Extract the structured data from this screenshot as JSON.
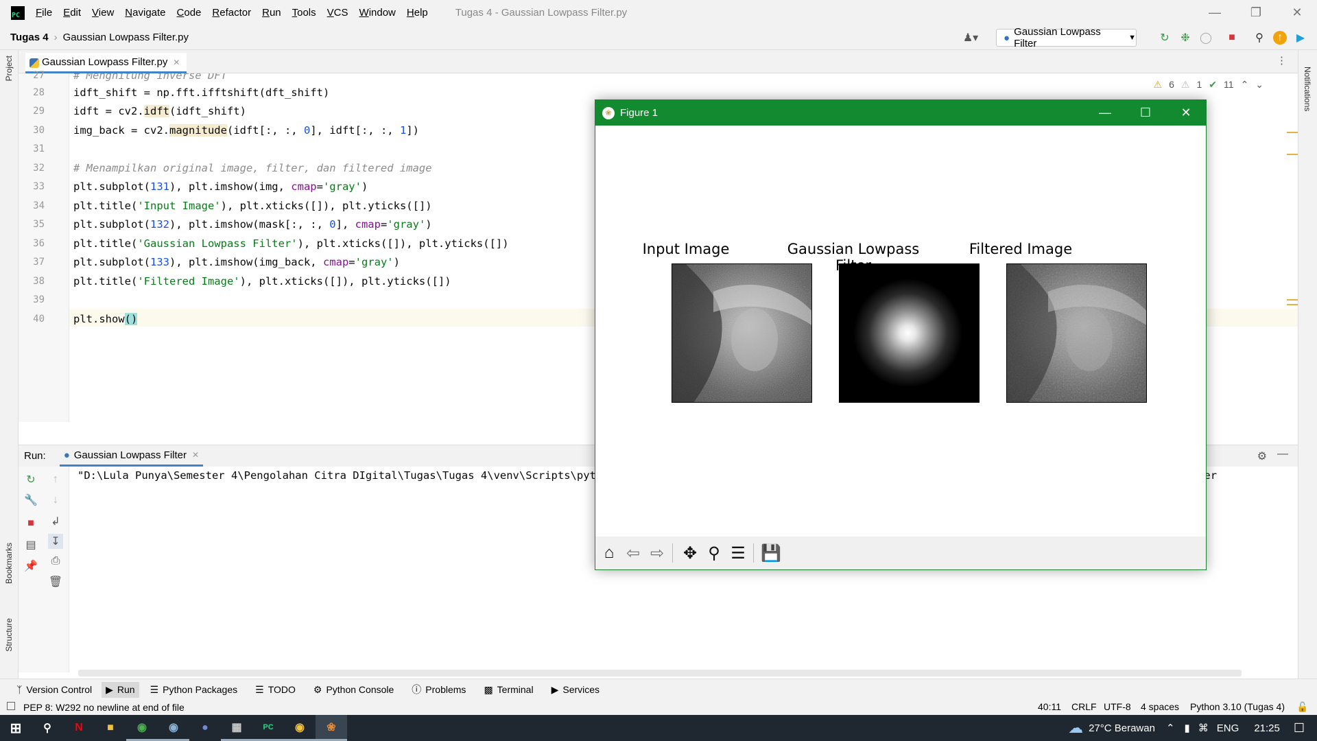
{
  "menubar": {
    "items": [
      "File",
      "Edit",
      "View",
      "Navigate",
      "Code",
      "Refactor",
      "Run",
      "Tools",
      "VCS",
      "Window",
      "Help"
    ],
    "title": "Tugas 4 - Gaussian Lowpass Filter.py"
  },
  "navbar": {
    "project": "Tugas 4",
    "file": "Gaussian Lowpass Filter.py",
    "run_config": "Gaussian Lowpass Filter"
  },
  "sidebar": {
    "project": "Project",
    "bookmarks": "Bookmarks",
    "structure": "Structure",
    "notifications": "Notifications"
  },
  "editor": {
    "tab": "Gaussian Lowpass Filter.py",
    "inspections": {
      "warnings": "6",
      "weak_warnings": "1",
      "ok": "11"
    },
    "line_numbers": [
      "27",
      "28",
      "29",
      "30",
      "31",
      "32",
      "33",
      "34",
      "35",
      "36",
      "37",
      "38",
      "39",
      "40"
    ]
  },
  "run": {
    "label": "Run:",
    "tab": "Gaussian Lowpass Filter",
    "console_line": "\"D:\\Lula Punya\\Semester 4\\Pengolahan Citra DIgital\\Tugas\\Tugas 4\\venv\\Scripts\\python.exe\" \"D:/Lula Punya/Semester 4/Pengolahan Citra DIgital/Tugas/Tugas 4/Gaussian Lowpass Filter"
  },
  "bottom_tools": [
    "Version Control",
    "Run",
    "Python Packages",
    "TODO",
    "Python Console",
    "Problems",
    "Terminal",
    "Services"
  ],
  "status": {
    "message": "PEP 8: W292 no newline at end of file",
    "position": "40:11",
    "line_sep": "CRLF",
    "encoding": "UTF-8",
    "indent": "4 spaces",
    "interpreter": "Python 3.10 (Tugas 4)"
  },
  "figure": {
    "title": "Figure 1",
    "subplots": [
      "Input Image",
      "Gaussian Lowpass Filter",
      "Filtered Image"
    ]
  },
  "taskbar": {
    "weather": "27°C Berawan",
    "lang": "ENG",
    "time": "21:25"
  }
}
